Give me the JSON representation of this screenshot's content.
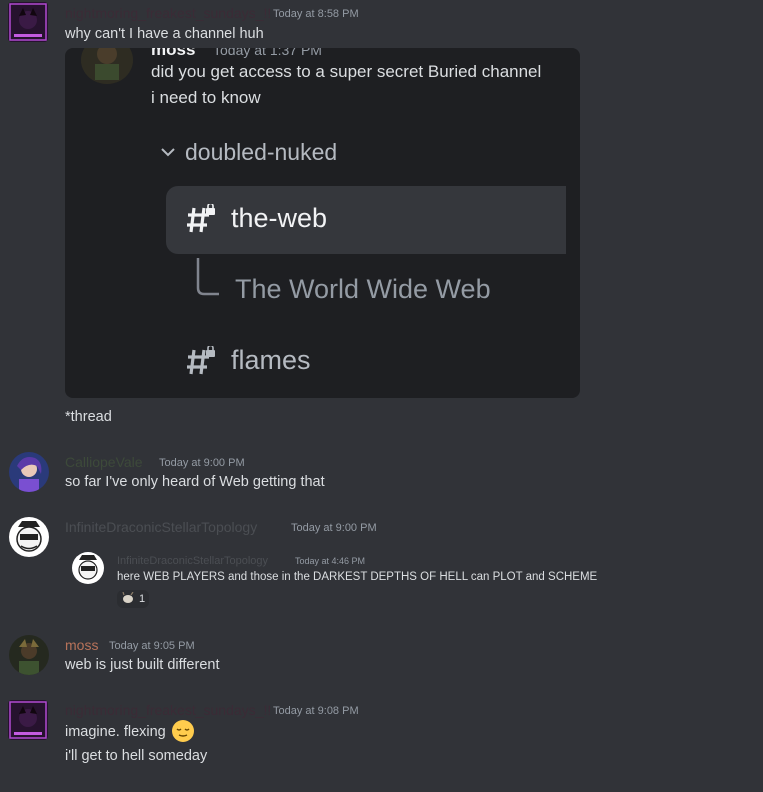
{
  "colors": {
    "background": "#313338",
    "username_nightmoring": "#3b2b36",
    "username_calliope": "#3d4a3a",
    "username_infinite": "#4b4e53",
    "username_moss": "#b8735a",
    "embed_bg": "#1e1f22"
  },
  "messages": [
    {
      "author": "nightmoring_freakest_sundays_!!",
      "timestamp": "Today at 8:58 PM",
      "lines": [
        "why can't I have a channel huh"
      ],
      "embed": {
        "author": "moss",
        "timestamp": "Today at 1:37 PM",
        "lines": [
          "did you get access to a super secret Buried channel",
          "i need to know"
        ],
        "category": "doubled-nuked",
        "channels": [
          {
            "name": "the-web",
            "selected": true
          },
          {
            "name": "flames",
            "selected": false
          }
        ],
        "thread": "The World Wide Web"
      },
      "after_embed": "*thread"
    },
    {
      "author": "CalliopeVale",
      "timestamp": "Today at 9:00 PM",
      "lines": [
        "so far I've only heard of Web getting that"
      ]
    },
    {
      "author": "InfiniteDraconicStellarTopology",
      "timestamp": "Today at 9:00 PM",
      "forward": {
        "author": "InfiniteDraconicStellarTopology",
        "timestamp": "Today at 4:46 PM",
        "text": "here WEB PLAYERS and those in the DARKEST DEPTHS OF HELL can PLOT and SCHEME",
        "reaction_count": "1",
        "reaction_icon": "goat-emoji-icon"
      }
    },
    {
      "author": "moss",
      "timestamp": "Today at 9:05 PM",
      "lines": [
        "web is just built different"
      ]
    },
    {
      "author": "nightmoring_freakest_sundays_!!",
      "timestamp": "Today at 9:08 PM",
      "lines": [
        "imagine. flexing",
        "i'll get to hell someday"
      ],
      "emoji": "relieved-face-emoji-icon"
    }
  ]
}
